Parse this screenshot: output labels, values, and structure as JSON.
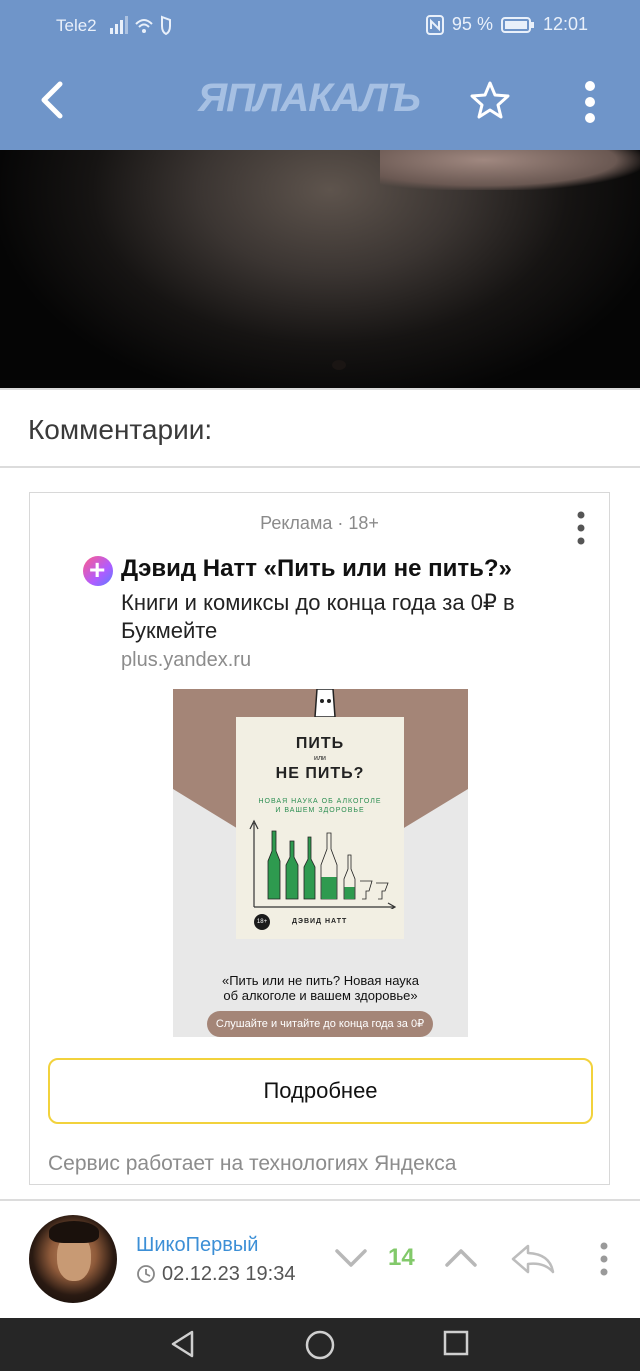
{
  "status_bar": {
    "carrier": "Tele2",
    "battery": "95 %",
    "time": "12:01",
    "icons": [
      "signal-icon",
      "wifi-icon",
      "vpn-shield-icon",
      "nfc-icon",
      "battery-icon"
    ]
  },
  "nav": {
    "logo": "ЯПЛАКАЛЪ",
    "icons": [
      "back-icon",
      "star-icon",
      "more-icon"
    ]
  },
  "comments_header": "Комментарии:",
  "ad": {
    "label": "Реклама · 18+",
    "title": "Дэвид Натт «Пить или не пить?»",
    "description": "Книги и комиксы до конца года за 0₽ в Букмейте",
    "domain": "plus.yandex.ru",
    "banner": {
      "book_title_1": "ПИТЬ",
      "book_title_2": "или",
      "book_title_3": "НЕ ПИТЬ?",
      "book_subtitle_1": "НОВАЯ НАУКА ОБ АЛКОГОЛЕ",
      "book_subtitle_2": "И ВАШЕМ ЗДОРОВЬЕ",
      "book_author": "ДЭВИД НАТТ",
      "age_badge": "18+",
      "caption_1": "«Пить или не пить? Новая наука",
      "caption_2": "об алкоголе и вашем здоровье»",
      "pill": "Слушайте и читайте до конца года за 0₽"
    },
    "cta": "Подробнее",
    "footer": "Сервис работает на технологиях Яндекса"
  },
  "comment": {
    "username": "ШикоПервый",
    "date": "02.12.23 19:34",
    "score": "14"
  },
  "colors": {
    "header_bg": "#6f95c9",
    "link": "#3c8fd6",
    "score": "#82c96a",
    "cta_border": "#f2d23c"
  }
}
